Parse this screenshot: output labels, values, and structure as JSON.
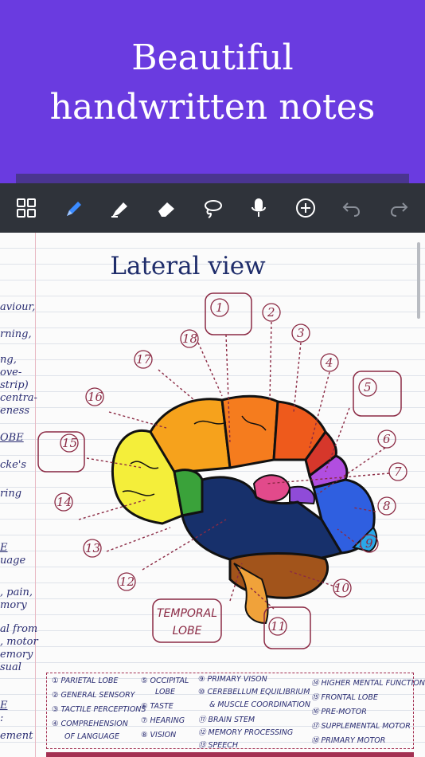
{
  "banner": {
    "line1": "Beautiful",
    "line2": "handwritten notes"
  },
  "toolbar": {
    "icons": [
      "grid-icon",
      "pen-icon",
      "highlighter-icon",
      "eraser-icon",
      "lasso-icon",
      "microphone-icon",
      "add-icon",
      "undo-icon",
      "redo-icon"
    ],
    "active_color": "#3b8bff",
    "icon_color": "#ffffff",
    "disabled_color": "#8a8f98"
  },
  "note": {
    "title": "Lateral view",
    "left_fragments": [
      "aviour,",
      "rning,",
      "ng,",
      "ove-",
      "strip)",
      "centra-",
      "eness",
      "OBE",
      "cke's",
      "ring",
      "E",
      "uage",
      ", pain,",
      "mory",
      "al from",
      ", motor",
      "emory",
      "sual",
      "E",
      ":",
      "ement"
    ],
    "labels": [
      "1",
      "2",
      "3",
      "4",
      "5",
      "6",
      "7",
      "8",
      "9",
      "10",
      "11",
      "12",
      "13",
      "14",
      "15",
      "16",
      "17",
      "18"
    ],
    "temporal_lobe": [
      "TEMPORAL",
      "LOBE"
    ],
    "legend": [
      "① PARIETAL LOBE",
      "② GENERAL SENSORY",
      "③ TACTILE PERCEPTIONS",
      "④ COMPREHENSION",
      "OF LANGUAGE",
      "⑤ OCCIPITAL",
      "LOBE",
      "⑥ TASTE",
      "⑦ HEARING",
      "⑧ VISION",
      "⑨ PRIMARY VISON",
      "⑩ CEREBELLUM EQUILIBRIUM",
      "& MUSCLE COORDINATION",
      "⑪ BRAIN STEM",
      "⑫ MEMORY PROCESSING",
      "⑬ SPEECH",
      "⑭ HIGHER MENTAL FUNCTIONS",
      "⑮ FRONTAL LOBE",
      "⑯ PRE-MOTOR",
      "⑰ SUPPLEMENTAL MOTOR",
      "⑱ PRIMARY MOTOR"
    ]
  }
}
